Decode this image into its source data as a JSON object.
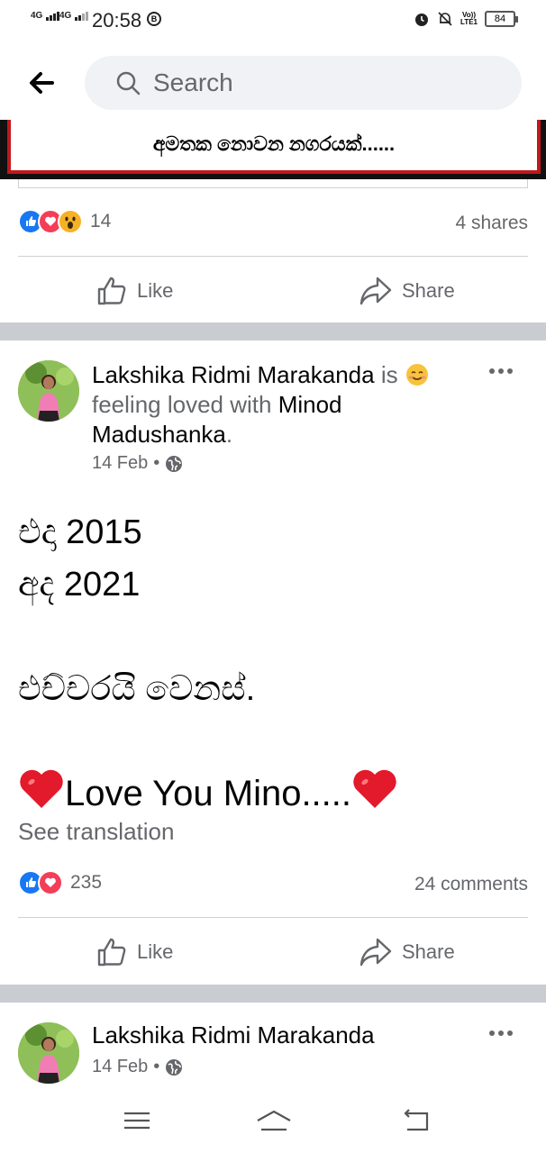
{
  "status_bar": {
    "net1": "4G",
    "net2": "4G",
    "time": "20:58",
    "b_icon": "B",
    "volte_top": "Vo))",
    "volte_bottom": "LTE1",
    "battery": "84"
  },
  "search": {
    "placeholder": "Search"
  },
  "top_post": {
    "caption": "අමතක නොවන නගරයක්......",
    "reaction_count": "14",
    "shares": "4 shares",
    "like_label": "Like",
    "share_label": "Share"
  },
  "post": {
    "author": "Lakshika Ridmi Marakanda",
    "is_text": " is ",
    "feeling_text": " feeling loved with ",
    "tagged": "Minod Madushanka",
    "period": ".",
    "date": "14 Feb",
    "dot": "•",
    "lines": [
      "එදා 2015",
      "අද 2021",
      "",
      "එච්චරයි වෙනස්.",
      ""
    ],
    "love_line": "Love You Mino.....",
    "see_translation": "See translation",
    "reaction_count": "235",
    "comments": "24 comments",
    "like_label": "Like",
    "share_label": "Share"
  },
  "next_post": {
    "author": "Lakshika Ridmi Marakanda",
    "date": "14 Feb",
    "dot": "•"
  },
  "colors": {
    "like_blue": "#1877f2",
    "love_red": "#f33e58",
    "wow_yellow": "#f7b125",
    "muted_text": "#65676b",
    "divider": "#c9ccd1"
  },
  "icons": [
    "back-arrow-icon",
    "search-icon",
    "like-icon",
    "share-icon",
    "globe-icon",
    "more-icon",
    "menu-icon",
    "home-icon",
    "back-nav-icon"
  ]
}
